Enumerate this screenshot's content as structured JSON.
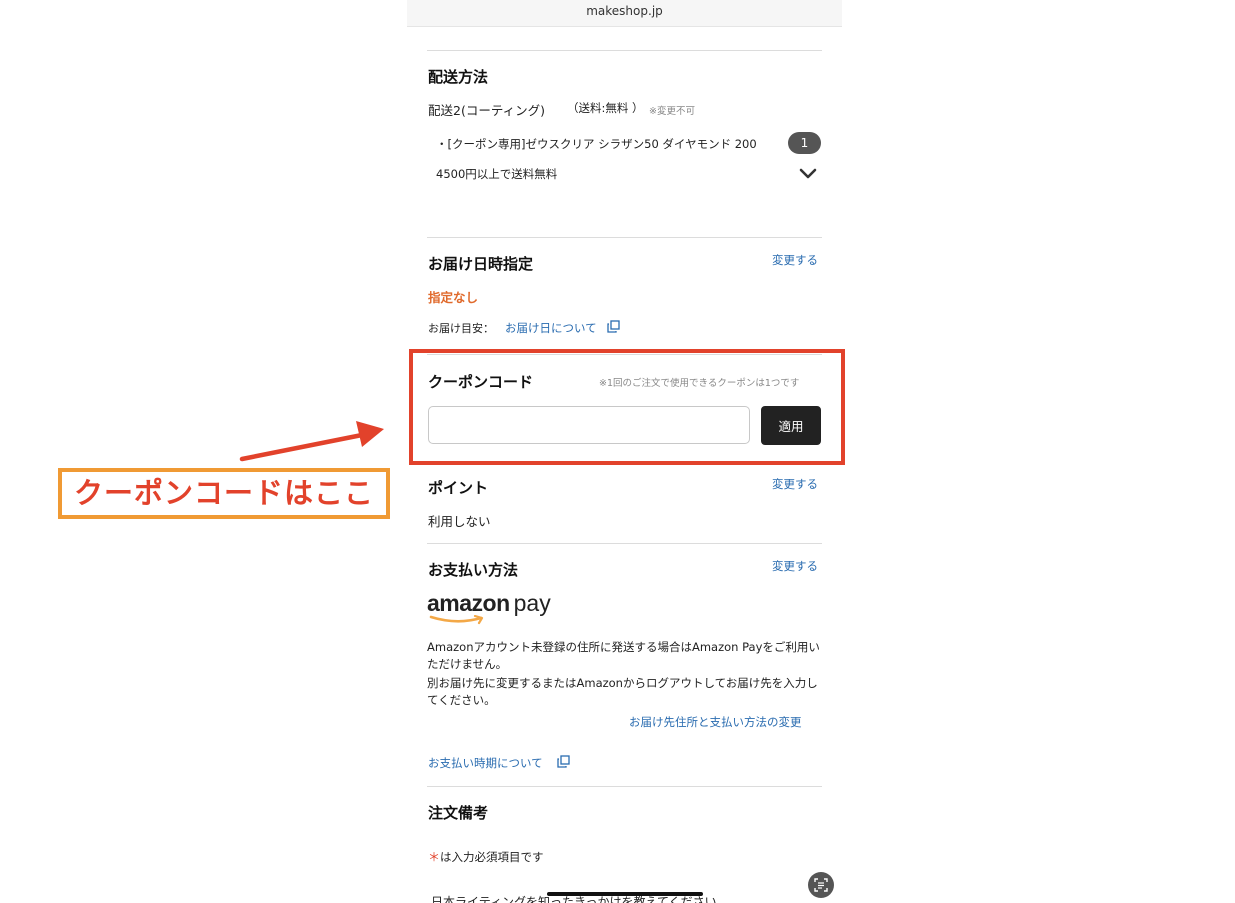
{
  "browser": {
    "url": "makeshop.jp"
  },
  "shipping": {
    "heading": "配送方法",
    "method": "配送2(コーティング)",
    "fee": "（送料:無料 ）",
    "note": "※変更不可",
    "item": "・[クーポン専用]ゼウスクリア シラザン50 ダイヤモンド 200",
    "qty": "1",
    "free_rule": "4500円以上で送料無料"
  },
  "delivery": {
    "heading": "お届け日時指定",
    "change": "変更する",
    "value": "指定なし",
    "estimate_label": "お届け目安：",
    "estimate_link": "お届け日について"
  },
  "coupon": {
    "heading": "クーポンコード",
    "note": "※1回のご注文で使用できるクーポンは1つです",
    "input_value": "",
    "apply_label": "適用"
  },
  "points": {
    "heading": "ポイント",
    "change": "変更する",
    "value": "利用しない"
  },
  "payment": {
    "heading": "お支払い方法",
    "change": "変更する",
    "logo_word": "amazon",
    "logo_pay": "pay",
    "para1": "Amazonアカウント未登録の住所に発送する場合はAmazon Payをご利用いただけません。",
    "para2": "別お届け先に変更するまたはAmazonからログアウトしてお届け先を入力してください。",
    "change_link": "お届け先住所と支払い方法の変更",
    "timing_link": "お支払い時期について"
  },
  "remarks": {
    "heading": "注文備考",
    "required_mark": "＊",
    "required_note": "は入力必須項目です",
    "cut_question": "日本ライティングを知ったきっかけを教えてください"
  },
  "annotation": {
    "label": "クーポンコードはここ"
  },
  "colors": {
    "highlight_red": "#e2422b",
    "label_orange": "#f09a34",
    "link_blue": "#2a6cb0",
    "accent_orange": "#e06a2c",
    "amazon_smile": "#f3a847"
  },
  "icons": {
    "expand": "chevron-down-icon",
    "external": "copy-window-icon",
    "scan": "text-scan-icon"
  }
}
